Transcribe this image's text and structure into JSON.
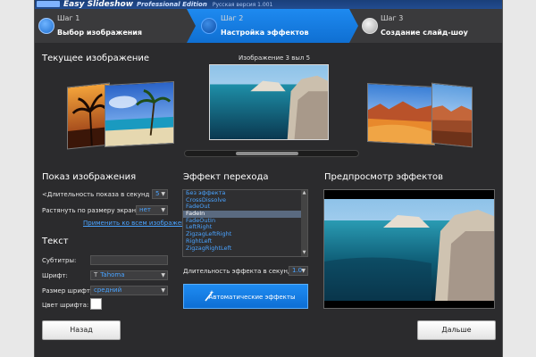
{
  "titlebar": {
    "app_name": "Easy Slideshow",
    "edition": "Professional Edition",
    "version": "Русская версия 1.001"
  },
  "steps": [
    {
      "number": "Шаг 1",
      "label": "Выбор изображения",
      "state": "done"
    },
    {
      "number": "Шаг 2",
      "label": "Настройка эффектов",
      "state": "active"
    },
    {
      "number": "Шаг 3",
      "label": "Создание слайд-шоу",
      "state": "pending"
    }
  ],
  "current_image": {
    "title": "Текущее изображение",
    "counter": "Изображение 3 выл 5",
    "carousel_position": 0.46
  },
  "display": {
    "title": "Показ изображения",
    "duration_label": "<Длительность показа в секунд",
    "duration_value": "5",
    "stretch_label": "Растянуть по размеру экрана:",
    "stretch_value": "нет",
    "apply_all_link": "Применить ко всем изображениям"
  },
  "text": {
    "title": "Текст",
    "subtitles_label": "Субтитры:",
    "subtitles_value": "",
    "font_label": "Шрифт:",
    "font_value": "Tahoma",
    "font_size_label": "Размер шрифта:",
    "font_size_value": "средний",
    "font_color_label": "Цвет шрифта:",
    "font_color": "#ffffff"
  },
  "effect": {
    "title": "Эффект перехода",
    "items": [
      "Без эффекта",
      "CrossDissolve",
      "FadeOut",
      "FadeIn",
      "FadeOutIn",
      "LeftRight",
      "ZigzagLeftRight",
      "RightLeft",
      "ZigzagRightLeft"
    ],
    "selected": "FadeIn",
    "duration_label": "Длительность эффекта в секунд",
    "duration_value": "1.0",
    "auto_button": "Автоматические эффекты"
  },
  "preview": {
    "title": "Предпросмотр эффектов"
  },
  "footer": {
    "back": "Назад",
    "next": "Дальше"
  },
  "colors": {
    "accent": "#1e8af0",
    "link": "#4aa3ff",
    "background": "#2b2b2d"
  }
}
